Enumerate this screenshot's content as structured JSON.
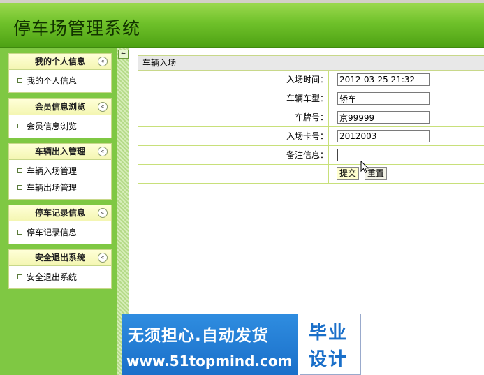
{
  "app": {
    "title": "停车场管理系统"
  },
  "sidebar": {
    "collapse_glyph": "«",
    "groups": [
      {
        "title": "我的个人信息",
        "items": [
          "我的个人信息"
        ]
      },
      {
        "title": "会员信息浏览",
        "items": [
          "会员信息浏览"
        ]
      },
      {
        "title": "车辆出入管理",
        "items": [
          "车辆入场管理",
          "车辆出场管理"
        ]
      },
      {
        "title": "停车记录信息",
        "items": [
          "停车记录信息"
        ]
      },
      {
        "title": "安全退出系统",
        "items": [
          "安全退出系统"
        ]
      }
    ]
  },
  "splitter": {
    "toggle_glyph": "←"
  },
  "form": {
    "title": "车辆入场",
    "fields": [
      {
        "label": "入场时间：",
        "value": "2012-03-25 21:32"
      },
      {
        "label": "车辆车型：",
        "value": "轿车"
      },
      {
        "label": "车牌号：",
        "value": "京99999"
      },
      {
        "label": "入场卡号：",
        "value": "2012003"
      },
      {
        "label": "备注信息：",
        "value": ""
      }
    ],
    "submit_label": "提交",
    "reset_label": "重置"
  },
  "watermark": {
    "line1": "无须担心.自动发货",
    "line2": "www.51topmind.com",
    "box_line1": "毕业",
    "box_line2": "设计"
  }
}
